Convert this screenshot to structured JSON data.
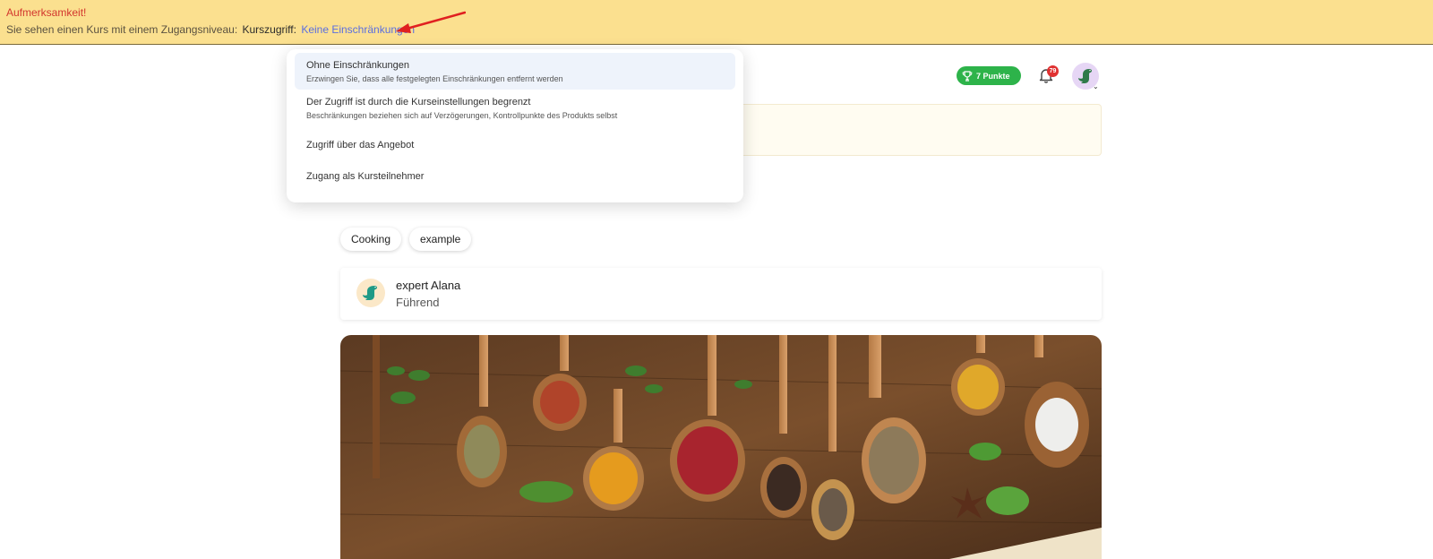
{
  "banner": {
    "title": "Aufmerksamkeit!",
    "text": "Sie sehen einen Kurs mit einem Zugangsniveau:",
    "label": "Kurszugriff:",
    "link": "Keine Einschränkungen"
  },
  "header": {
    "points": "7 Punkte",
    "notifications_count": "79"
  },
  "dropdown": {
    "items": [
      {
        "title": "Ohne Einschränkungen",
        "subtitle": "Erzwingen Sie, dass alle festgelegten Einschränkungen entfernt werden"
      },
      {
        "title": "Der Zugriff ist durch die Kurseinstellungen begrenzt",
        "subtitle": "Beschränkungen beziehen sich auf Verzögerungen, Kontrollpunkte des Produkts selbst"
      },
      {
        "title": "Zugriff über das Angebot"
      },
      {
        "title": "Zugang als Kursteilnehmer"
      }
    ]
  },
  "tags": [
    "Cooking",
    "example"
  ],
  "author": {
    "name": "expert Alana",
    "role": "Führend"
  },
  "colors": {
    "banner_bg": "#fbe08f",
    "banner_title": "#d2362e",
    "link": "#5a6ee0",
    "points_bg": "#2db34a",
    "badge": "#e03131",
    "dropdown_active": "#eef3fb"
  },
  "icons": [
    "arrow-annotation-icon",
    "trophy-icon",
    "bell-icon",
    "dinosaur-avatar-icon",
    "chevron-down-icon"
  ]
}
